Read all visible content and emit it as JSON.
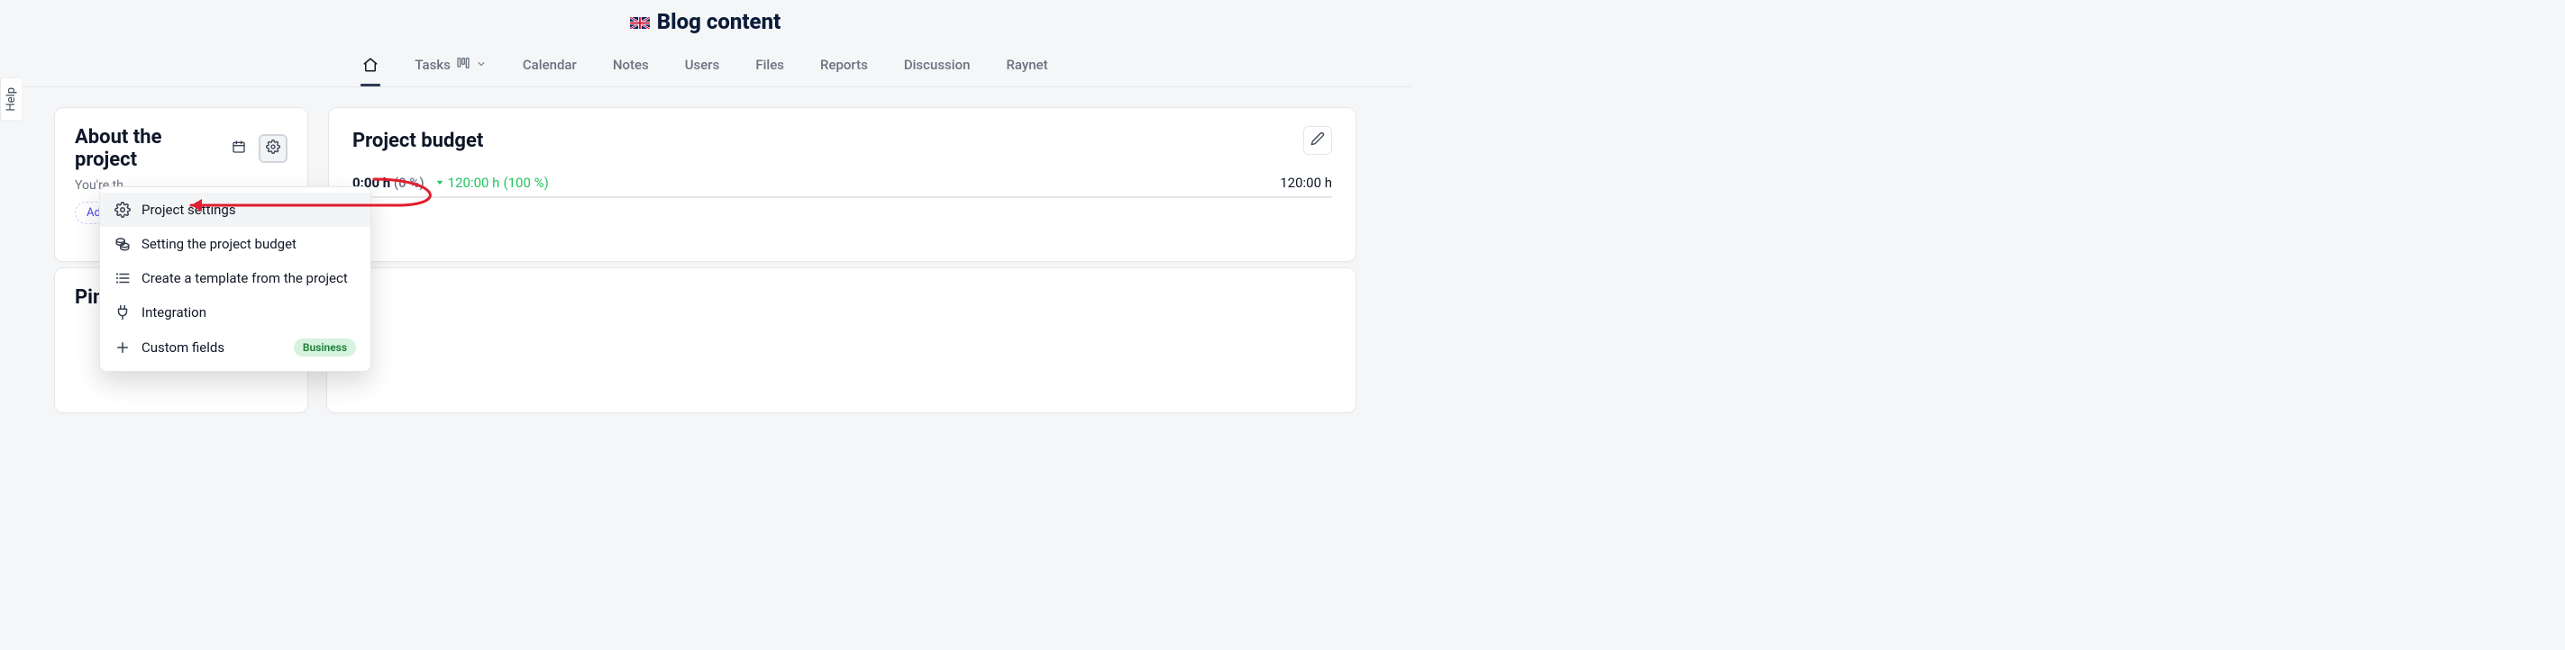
{
  "help_label": "Help",
  "header": {
    "title": "Blog content"
  },
  "tabs": {
    "tasks": "Tasks",
    "calendar": "Calendar",
    "notes": "Notes",
    "users": "Users",
    "files": "Files",
    "reports": "Reports",
    "discussion": "Discussion",
    "raynet": "Raynet"
  },
  "about": {
    "title": "About the project",
    "subtitle_truncated": "You're th",
    "add_desc_truncated": "Add a"
  },
  "budget": {
    "title": "Project budget",
    "spent_value": "0:00 h",
    "spent_pct": "(0 %)",
    "remaining_value": "120:00 h",
    "remaining_pct": "(100 %)",
    "total_value": "120:00 h"
  },
  "pinned": {
    "title_truncated": "Pinn"
  },
  "menu": {
    "items": [
      {
        "label": "Project settings"
      },
      {
        "label": "Setting the project budget"
      },
      {
        "label": "Create a template from the project"
      },
      {
        "label": "Integration"
      },
      {
        "label": "Custom fields",
        "badge": "Business"
      }
    ]
  }
}
